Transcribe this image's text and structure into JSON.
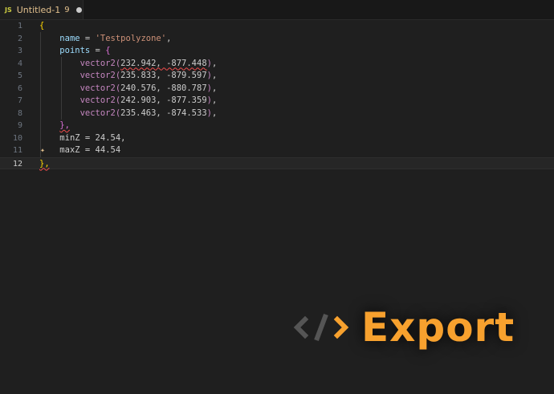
{
  "tab": {
    "icon": "JS",
    "title": "Untitled-1",
    "problem_count": "9"
  },
  "editor": {
    "lines": [
      {
        "n": "1"
      },
      {
        "n": "2"
      },
      {
        "n": "3"
      },
      {
        "n": "4"
      },
      {
        "n": "5"
      },
      {
        "n": "6"
      },
      {
        "n": "7"
      },
      {
        "n": "8"
      },
      {
        "n": "9"
      },
      {
        "n": "10"
      },
      {
        "n": "11"
      },
      {
        "n": "12"
      }
    ],
    "tokens": {
      "open_brace": "{",
      "name_key": "name",
      "eq": " = ",
      "name_value": "'Testpolyzone'",
      "comma": ",",
      "points_key": "points",
      "points_open": "{",
      "vector_fn": "vector2",
      "v1_args": "232.942, -877.448",
      "v2_args": "235.833, -879.597",
      "v3_args": "240.576, -880.787",
      "v4_args": "242.903, -877.359",
      "v5_args": "235.463, -874.533",
      "points_close": "},",
      "minz": "minZ = 24.54,",
      "maxz": "maxZ = 44.54",
      "close_brace": "},"
    }
  },
  "watermark": {
    "label": "Export",
    "icon": "code-brackets-icon",
    "accent": "#f7a12e"
  }
}
